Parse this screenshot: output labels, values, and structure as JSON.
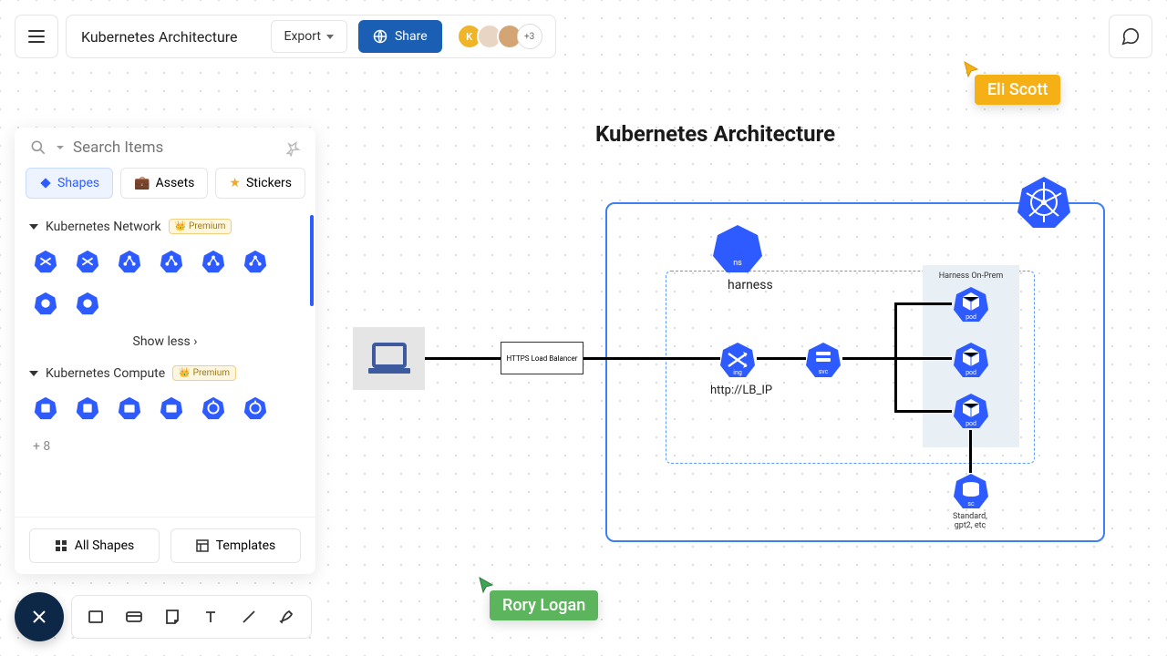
{
  "header": {
    "doc_title": "Kubernetes Architecture",
    "export_label": "Export",
    "share_label": "Share",
    "avatar1_initial": "K",
    "avatar_more": "+3"
  },
  "panel": {
    "search_placeholder": "Search Items",
    "tabs": {
      "shapes": "Shapes",
      "assets": "Assets",
      "stickers": "Stickers"
    },
    "section1_title": "Kubernetes Network",
    "section2_title": "Kubernetes Compute",
    "premium_label": "Premium",
    "show_less": "Show less",
    "plus_more": "+ 8",
    "all_shapes": "All Shapes",
    "templates": "Templates"
  },
  "canvas": {
    "title": "Kubernetes Architecture",
    "ns_shape_label": "ns",
    "ns_text": "harness",
    "lb_text": "HTTPS Load Balancer",
    "ing_shape_label": "ing",
    "ing_text": "http://LB_IP",
    "svc_shape_label": "svc",
    "pod_group_title": "Harness On-Prem",
    "pod_label": "pod",
    "sc_shape_label": "sc",
    "sc_text": "Standard, gpt2, etc"
  },
  "cursors": {
    "user1": "Eli Scott",
    "user2": "Rory Logan"
  }
}
